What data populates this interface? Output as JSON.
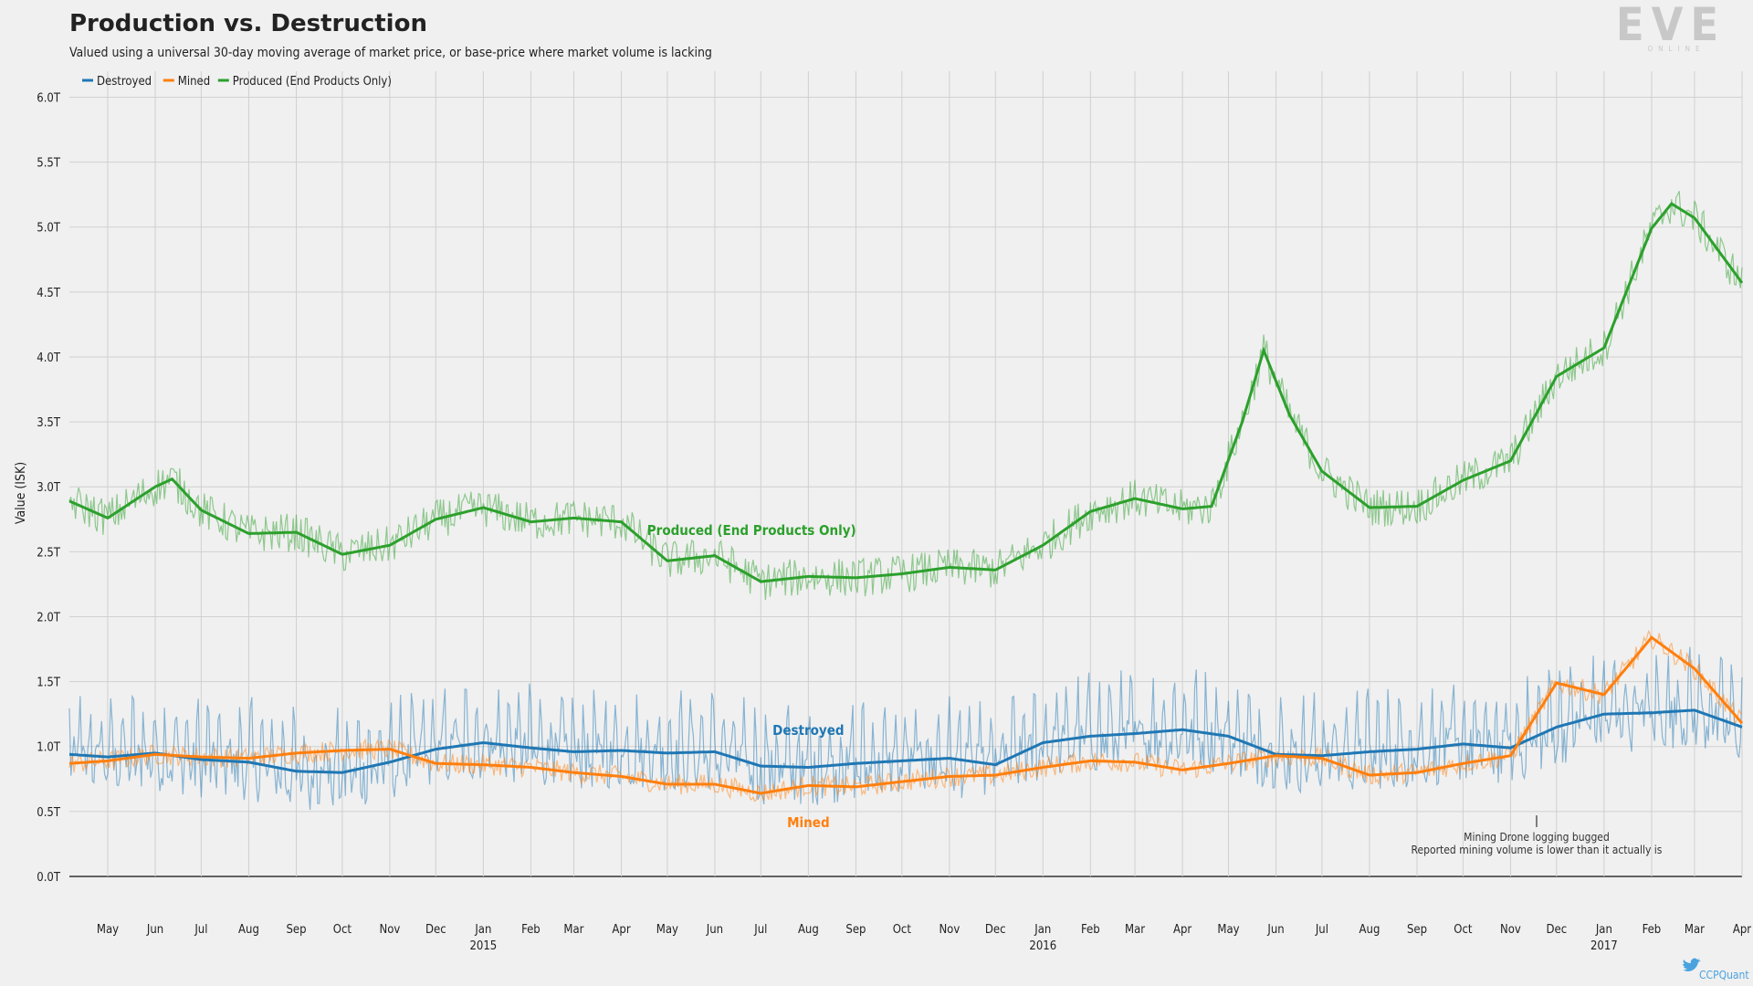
{
  "chart_data": {
    "type": "line",
    "title": "Production vs. Destruction",
    "subtitle": "Valued using a universal 30-day moving average of market price, or base-price where market volume is lacking",
    "ylabel": "Value (ISK)",
    "xlabel": "",
    "ylim": [
      0,
      6.2
    ],
    "yticks": [
      "0.0T",
      "0.5T",
      "1.0T",
      "1.5T",
      "2.0T",
      "2.5T",
      "3.0T",
      "3.5T",
      "4.0T",
      "4.5T",
      "5.0T",
      "5.5T",
      "6.0T"
    ],
    "x_range": [
      "2014-04-06",
      "2017-04-01"
    ],
    "month_ticks": [
      {
        "date": "2014-05-01",
        "label": "May"
      },
      {
        "date": "2014-06-01",
        "label": "Jun"
      },
      {
        "date": "2014-07-01",
        "label": "Jul"
      },
      {
        "date": "2014-08-01",
        "label": "Aug"
      },
      {
        "date": "2014-09-01",
        "label": "Sep"
      },
      {
        "date": "2014-10-01",
        "label": "Oct"
      },
      {
        "date": "2014-11-01",
        "label": "Nov"
      },
      {
        "date": "2014-12-01",
        "label": "Dec"
      },
      {
        "date": "2015-01-01",
        "label": "Jan",
        "year": "2015"
      },
      {
        "date": "2015-02-01",
        "label": "Feb"
      },
      {
        "date": "2015-03-01",
        "label": "Mar"
      },
      {
        "date": "2015-04-01",
        "label": "Apr"
      },
      {
        "date": "2015-05-01",
        "label": "May"
      },
      {
        "date": "2015-06-01",
        "label": "Jun"
      },
      {
        "date": "2015-07-01",
        "label": "Jul"
      },
      {
        "date": "2015-08-01",
        "label": "Aug"
      },
      {
        "date": "2015-09-01",
        "label": "Sep"
      },
      {
        "date": "2015-10-01",
        "label": "Oct"
      },
      {
        "date": "2015-11-01",
        "label": "Nov"
      },
      {
        "date": "2015-12-01",
        "label": "Dec"
      },
      {
        "date": "2016-01-01",
        "label": "Jan",
        "year": "2016"
      },
      {
        "date": "2016-02-01",
        "label": "Feb"
      },
      {
        "date": "2016-03-01",
        "label": "Mar"
      },
      {
        "date": "2016-04-01",
        "label": "Apr"
      },
      {
        "date": "2016-05-01",
        "label": "May"
      },
      {
        "date": "2016-06-01",
        "label": "Jun"
      },
      {
        "date": "2016-07-01",
        "label": "Jul"
      },
      {
        "date": "2016-08-01",
        "label": "Aug"
      },
      {
        "date": "2016-09-01",
        "label": "Sep"
      },
      {
        "date": "2016-10-01",
        "label": "Oct"
      },
      {
        "date": "2016-11-01",
        "label": "Nov"
      },
      {
        "date": "2016-12-01",
        "label": "Dec"
      },
      {
        "date": "2017-01-01",
        "label": "Jan",
        "year": "2017"
      },
      {
        "date": "2017-02-01",
        "label": "Feb"
      },
      {
        "date": "2017-03-01",
        "label": "Mar"
      },
      {
        "date": "2017-04-01",
        "label": "Apr"
      }
    ],
    "legend_position": "top-left",
    "grid": true,
    "series": [
      {
        "name": "Destroyed",
        "color": "#1f77b4",
        "label": "Destroyed",
        "trend": [
          [
            "2014-04-06",
            0.94
          ],
          [
            "2014-05-01",
            0.92
          ],
          [
            "2014-06-01",
            0.95
          ],
          [
            "2014-07-01",
            0.9
          ],
          [
            "2014-08-01",
            0.88
          ],
          [
            "2014-09-01",
            0.81
          ],
          [
            "2014-10-01",
            0.8
          ],
          [
            "2014-11-01",
            0.88
          ],
          [
            "2014-12-01",
            0.98
          ],
          [
            "2015-01-01",
            1.03
          ],
          [
            "2015-02-01",
            0.99
          ],
          [
            "2015-03-01",
            0.96
          ],
          [
            "2015-04-01",
            0.97
          ],
          [
            "2015-05-01",
            0.95
          ],
          [
            "2015-06-01",
            0.96
          ],
          [
            "2015-07-01",
            0.85
          ],
          [
            "2015-08-01",
            0.84
          ],
          [
            "2015-09-01",
            0.87
          ],
          [
            "2015-10-01",
            0.89
          ],
          [
            "2015-11-01",
            0.91
          ],
          [
            "2015-12-01",
            0.86
          ],
          [
            "2016-01-01",
            1.03
          ],
          [
            "2016-02-01",
            1.08
          ],
          [
            "2016-03-01",
            1.1
          ],
          [
            "2016-04-01",
            1.13
          ],
          [
            "2016-05-01",
            1.08
          ],
          [
            "2016-06-01",
            0.94
          ],
          [
            "2016-07-01",
            0.93
          ],
          [
            "2016-08-01",
            0.96
          ],
          [
            "2016-09-01",
            0.98
          ],
          [
            "2016-10-01",
            1.02
          ],
          [
            "2016-11-01",
            0.99
          ],
          [
            "2016-12-01",
            1.15
          ],
          [
            "2017-01-01",
            1.25
          ],
          [
            "2017-02-01",
            1.26
          ],
          [
            "2017-03-01",
            1.28
          ],
          [
            "2017-04-01",
            1.15
          ]
        ],
        "daily_spread": 0.22
      },
      {
        "name": "Mined",
        "color": "#ff7f0e",
        "label": "Mined",
        "trend": [
          [
            "2014-04-06",
            0.87
          ],
          [
            "2014-05-01",
            0.89
          ],
          [
            "2014-06-01",
            0.94
          ],
          [
            "2014-07-01",
            0.92
          ],
          [
            "2014-08-01",
            0.91
          ],
          [
            "2014-09-01",
            0.95
          ],
          [
            "2014-10-01",
            0.97
          ],
          [
            "2014-11-01",
            0.98
          ],
          [
            "2014-12-01",
            0.87
          ],
          [
            "2015-01-01",
            0.86
          ],
          [
            "2015-02-01",
            0.84
          ],
          [
            "2015-03-01",
            0.8
          ],
          [
            "2015-04-01",
            0.77
          ],
          [
            "2015-05-01",
            0.71
          ],
          [
            "2015-06-01",
            0.71
          ],
          [
            "2015-07-01",
            0.64
          ],
          [
            "2015-08-01",
            0.7
          ],
          [
            "2015-09-01",
            0.69
          ],
          [
            "2015-10-01",
            0.73
          ],
          [
            "2015-11-01",
            0.77
          ],
          [
            "2015-12-01",
            0.78
          ],
          [
            "2016-01-01",
            0.84
          ],
          [
            "2016-02-01",
            0.89
          ],
          [
            "2016-03-01",
            0.88
          ],
          [
            "2016-04-01",
            0.82
          ],
          [
            "2016-05-01",
            0.87
          ],
          [
            "2016-06-01",
            0.93
          ],
          [
            "2016-07-01",
            0.91
          ],
          [
            "2016-08-01",
            0.78
          ],
          [
            "2016-09-01",
            0.8
          ],
          [
            "2016-10-01",
            0.87
          ],
          [
            "2016-11-01",
            0.93
          ],
          [
            "2016-12-01",
            1.49
          ],
          [
            "2017-01-01",
            1.4
          ],
          [
            "2017-02-01",
            1.84
          ],
          [
            "2017-03-01",
            1.6
          ],
          [
            "2017-04-01",
            1.18
          ]
        ],
        "daily_spread": 0.08
      },
      {
        "name": "Produced (End Products Only)",
        "color": "#2ca02c",
        "label": "Produced (End Products Only)",
        "trend": [
          [
            "2014-04-06",
            2.89
          ],
          [
            "2014-05-01",
            2.76
          ],
          [
            "2014-06-01",
            3.0
          ],
          [
            "2014-06-12",
            3.06
          ],
          [
            "2014-07-01",
            2.82
          ],
          [
            "2014-08-01",
            2.64
          ],
          [
            "2014-09-01",
            2.65
          ],
          [
            "2014-10-01",
            2.48
          ],
          [
            "2014-11-01",
            2.55
          ],
          [
            "2014-12-01",
            2.75
          ],
          [
            "2015-01-01",
            2.84
          ],
          [
            "2015-02-01",
            2.73
          ],
          [
            "2015-03-01",
            2.76
          ],
          [
            "2015-04-01",
            2.73
          ],
          [
            "2015-05-01",
            2.43
          ],
          [
            "2015-06-01",
            2.47
          ],
          [
            "2015-07-01",
            2.27
          ],
          [
            "2015-08-01",
            2.31
          ],
          [
            "2015-09-01",
            2.3
          ],
          [
            "2015-10-01",
            2.33
          ],
          [
            "2015-11-01",
            2.38
          ],
          [
            "2015-12-01",
            2.36
          ],
          [
            "2016-01-01",
            2.55
          ],
          [
            "2016-02-01",
            2.81
          ],
          [
            "2016-03-01",
            2.91
          ],
          [
            "2016-04-01",
            2.83
          ],
          [
            "2016-04-20",
            2.85
          ],
          [
            "2016-05-10",
            3.5
          ],
          [
            "2016-05-24",
            4.05
          ],
          [
            "2016-06-10",
            3.55
          ],
          [
            "2016-07-01",
            3.12
          ],
          [
            "2016-08-01",
            2.84
          ],
          [
            "2016-09-01",
            2.85
          ],
          [
            "2016-10-01",
            3.05
          ],
          [
            "2016-11-01",
            3.2
          ],
          [
            "2016-12-01",
            3.85
          ],
          [
            "2017-01-01",
            4.07
          ],
          [
            "2017-02-01",
            4.99
          ],
          [
            "2017-02-14",
            5.18
          ],
          [
            "2017-03-01",
            5.07
          ],
          [
            "2017-04-01",
            4.57
          ]
        ],
        "daily_spread": 0.15
      }
    ],
    "inline_labels": [
      "Produced (End Products Only)",
      "Destroyed",
      "Mined"
    ],
    "annotations": [
      {
        "date": "2016-11-18",
        "value": 0.48,
        "text": [
          "Mining Drone logging bugged",
          "Reported mining volume is lower than it actually is"
        ]
      }
    ]
  },
  "branding": {
    "logo_text": "EVE",
    "logo_subtext": "ONLINE",
    "credit": "CCPQuant"
  }
}
